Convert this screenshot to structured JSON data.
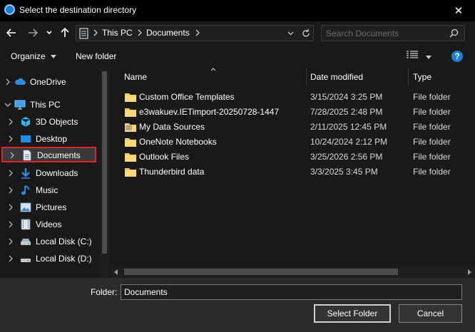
{
  "window": {
    "title": "Select the destination directory",
    "close_glyph": "✕"
  },
  "address_bar": {
    "breadcrumbs": [
      "This PC",
      "Documents"
    ]
  },
  "search": {
    "placeholder": "Search Documents"
  },
  "toolbar": {
    "organize_label": "Organize",
    "new_folder_label": "New folder",
    "help_glyph": "?"
  },
  "sidebar": {
    "items": [
      {
        "label": "OneDrive",
        "icon": "cloud-icon"
      },
      {
        "label": "This PC",
        "icon": "computer-icon"
      },
      {
        "label": "3D Objects",
        "icon": "cube-icon"
      },
      {
        "label": "Desktop",
        "icon": "desktop-icon"
      },
      {
        "label": "Documents",
        "icon": "document-icon",
        "selected": true
      },
      {
        "label": "Downloads",
        "icon": "download-arrow-icon"
      },
      {
        "label": "Music",
        "icon": "music-note-icon"
      },
      {
        "label": "Pictures",
        "icon": "picture-icon"
      },
      {
        "label": "Videos",
        "icon": "video-icon"
      },
      {
        "label": "Local Disk (C:)",
        "icon": "drive-icon"
      },
      {
        "label": "Local Disk (D:)",
        "icon": "drive-icon"
      }
    ]
  },
  "file_list": {
    "columns": [
      "Name",
      "Date modified",
      "Type"
    ],
    "rows": [
      {
        "name": "Custom Office Templates",
        "date": "3/15/2024 3:25 PM",
        "type": "File folder",
        "icon": "folder-icon"
      },
      {
        "name": "e3wakuev.IETimport-20250728-1447",
        "date": "7/28/2025 2:48 PM",
        "type": "File folder",
        "icon": "folder-icon"
      },
      {
        "name": "My Data Sources",
        "date": "2/11/2025 12:45 PM",
        "type": "File folder",
        "icon": "data-sources-folder-icon"
      },
      {
        "name": "OneNote Notebooks",
        "date": "10/24/2024 2:12 PM",
        "type": "File folder",
        "icon": "folder-icon"
      },
      {
        "name": "Outlook Files",
        "date": "3/25/2026 2:56 PM",
        "type": "File folder",
        "icon": "folder-icon"
      },
      {
        "name": "Thunderbird data",
        "date": "3/3/2025 3:45 PM",
        "type": "File folder",
        "icon": "folder-icon"
      }
    ]
  },
  "footer": {
    "folder_label": "Folder:",
    "folder_value": "Documents",
    "select_button": "Select Folder",
    "cancel_button": "Cancel"
  },
  "colors": {
    "background": "#191919",
    "footer": "#2b2b2b",
    "selection_outline": "#e0242b",
    "folder_yellow": "#f6c95b",
    "accent_blue": "#1a7fd6"
  }
}
